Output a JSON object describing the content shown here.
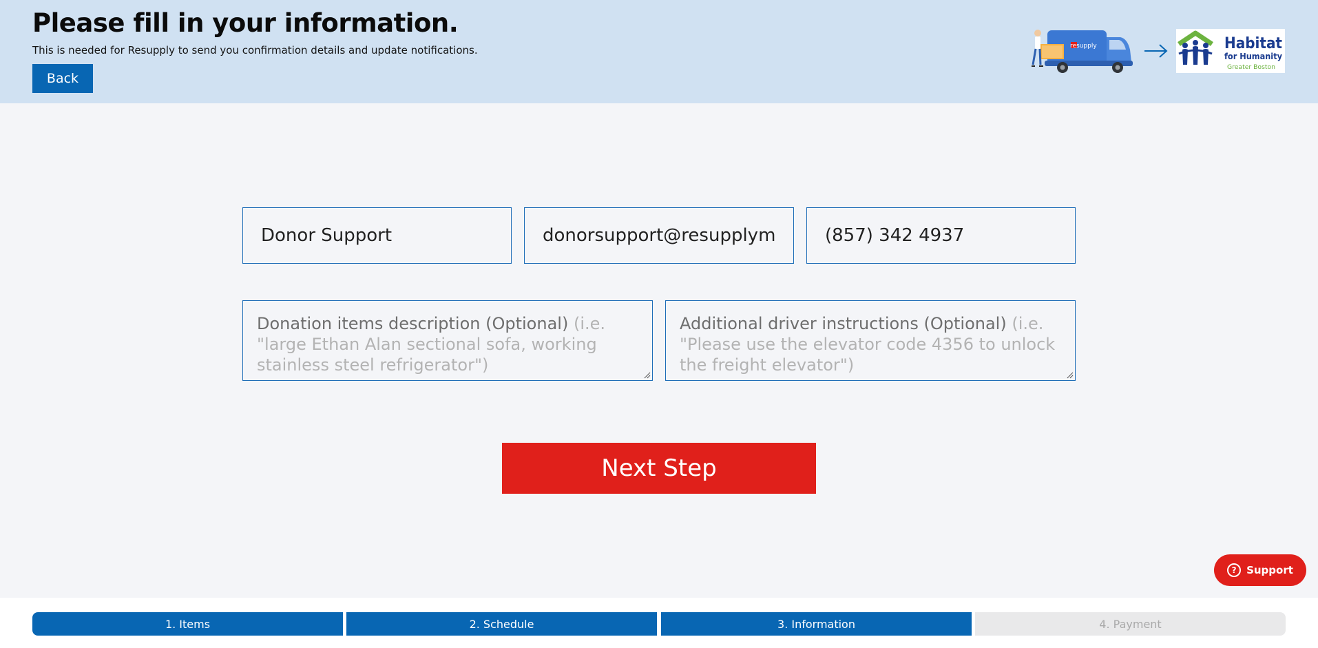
{
  "header": {
    "title": "Please fill in your information.",
    "subtitle": "This is needed for Resupply to send you confirmation details and update notifications.",
    "back_label": "Back",
    "truck_brand": "resupply",
    "partner_logo": {
      "line1": "Habitat",
      "line2": "for Humanity",
      "line3": "Greater Boston"
    }
  },
  "form": {
    "name_value": "Donor Support",
    "email_value": "donorsupport@resupplym",
    "phone_value": "(857) 342 4937",
    "description_label": "Donation items description (Optional)",
    "description_hint": "(i.e. \"large Ethan Alan sectional sofa, working stainless steel refrigerator\")",
    "instructions_label": "Additional driver instructions (Optional)",
    "instructions_hint": "(i.e. \"Please use the elevator code 4356 to unlock the freight elevator\")",
    "next_label": "Next Step"
  },
  "support_label": "Support",
  "steps": [
    {
      "label": "1. Items",
      "state": "complete"
    },
    {
      "label": "2. Schedule",
      "state": "complete"
    },
    {
      "label": "3. Information",
      "state": "current"
    },
    {
      "label": "4. Payment",
      "state": "pending"
    }
  ],
  "colors": {
    "header_bg": "#d0e1f2",
    "primary_blue": "#0866b3",
    "accent_red": "#e0201b",
    "habitat_green": "#6cb33f",
    "habitat_blue": "#1a3b8f"
  }
}
